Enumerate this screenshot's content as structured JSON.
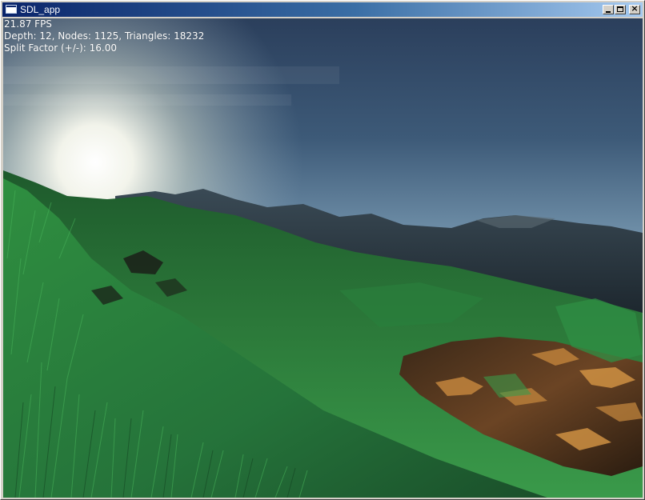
{
  "window": {
    "title": "SDL_app",
    "controls": {
      "minimize": "minimize",
      "maximize": "maximize",
      "close": "×"
    }
  },
  "hud": {
    "fps": "21.87 FPS",
    "stats": "Depth: 12, Nodes: 1125, Triangles: 18232",
    "split_factor": "Split Factor (+/-): 16.00"
  },
  "colors": {
    "titlebar_start": "#0a246a",
    "titlebar_end": "#a6caf0",
    "window_face": "#d4d0c8",
    "sky_top": "#2b3f5c",
    "sun": "#ffffff",
    "grass": "#2f8a3c",
    "sand": "#c8843a",
    "mountains": "#1f2a33"
  }
}
